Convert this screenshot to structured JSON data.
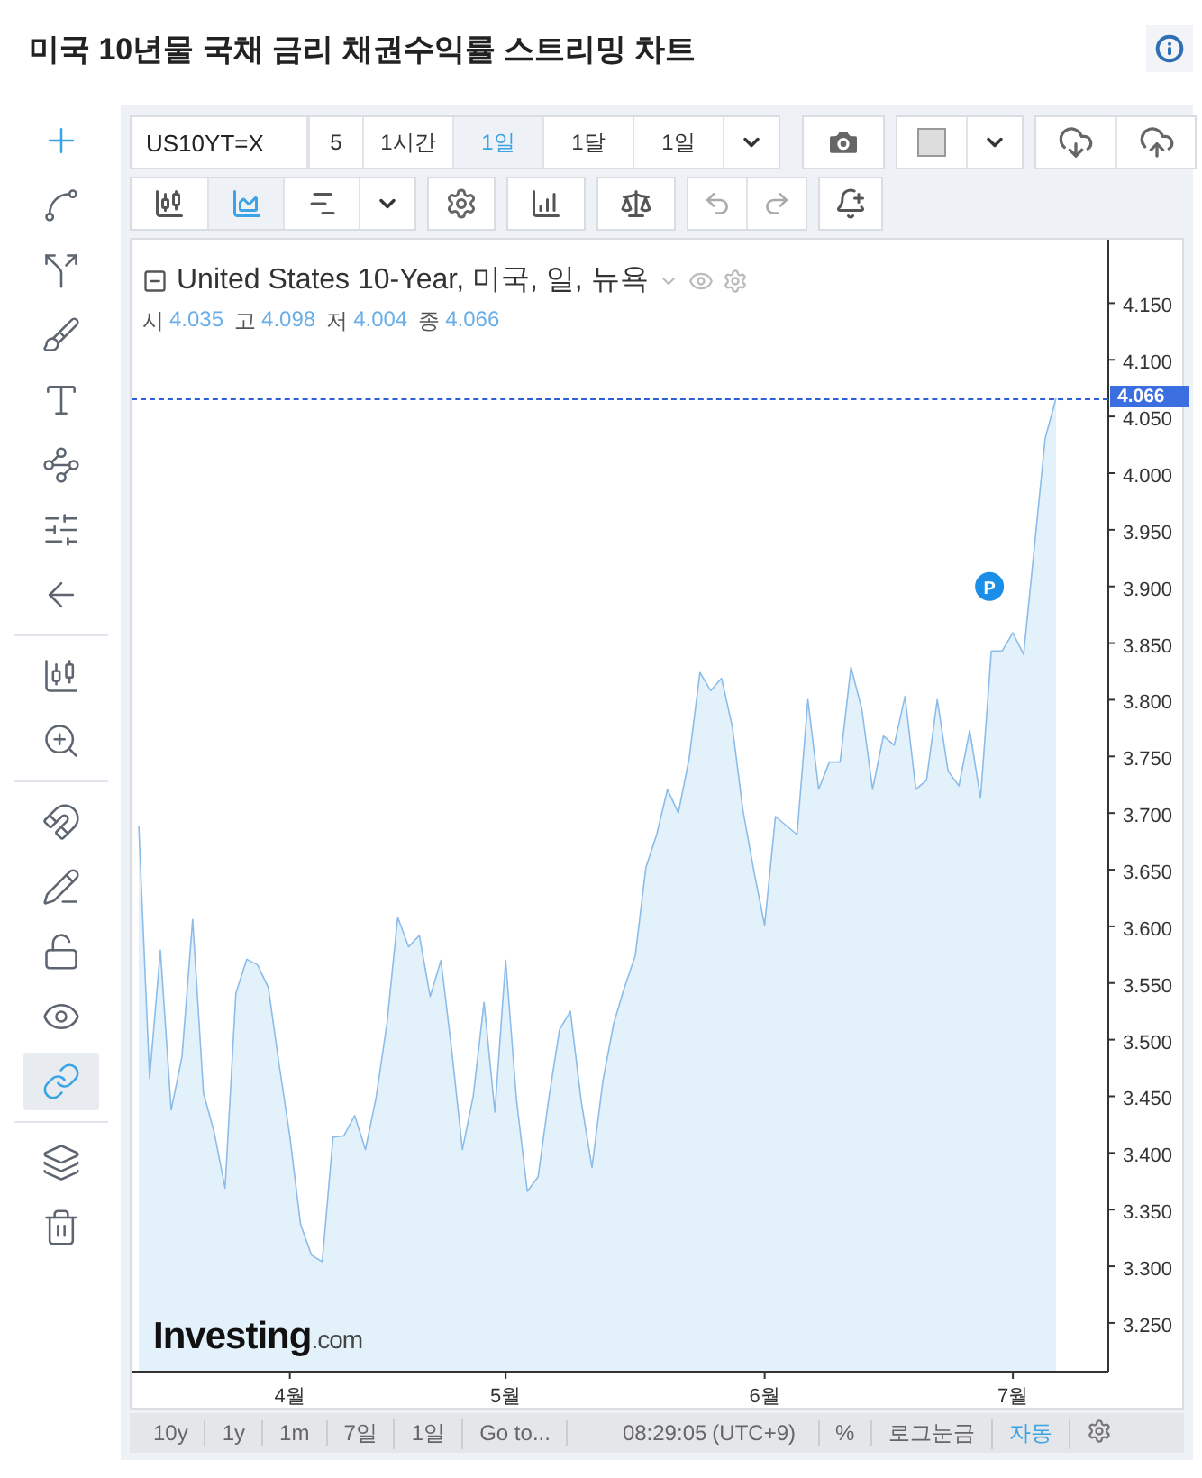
{
  "page_title": "미국 10년물 국채 금리 채권수익률 스트리밍 차트",
  "left_tools": [
    {
      "kind": "crosshair",
      "selected": true
    },
    {
      "kind": "line",
      "selected": false
    },
    {
      "kind": "fork",
      "selected": false
    },
    {
      "kind": "brush",
      "selected": false
    },
    {
      "kind": "text",
      "selected": false
    },
    {
      "kind": "pattern",
      "selected": false
    },
    {
      "kind": "measure",
      "selected": false
    },
    {
      "kind": "back",
      "selected": false
    },
    {
      "kind": "divider"
    },
    {
      "kind": "candle-zoom",
      "selected": false
    },
    {
      "kind": "zoom",
      "selected": false
    },
    {
      "kind": "divider"
    },
    {
      "kind": "magnet",
      "selected": false
    },
    {
      "kind": "pencil-lock",
      "selected": false
    },
    {
      "kind": "lock",
      "selected": false
    },
    {
      "kind": "eye",
      "selected": false
    },
    {
      "kind": "link",
      "selected": true
    },
    {
      "kind": "divider"
    },
    {
      "kind": "layers",
      "selected": false
    },
    {
      "kind": "trash",
      "selected": false
    }
  ],
  "toolbar": {
    "symbol": "US10YT=X",
    "intervals": [
      {
        "label": "5",
        "selected": false
      },
      {
        "label": "1시간",
        "selected": false
      },
      {
        "label": "1일",
        "selected": true
      },
      {
        "label": "1달",
        "selected": false
      },
      {
        "label": "1일",
        "selected": false
      }
    ]
  },
  "chart_types": [
    {
      "kind": "candles",
      "selected": false
    },
    {
      "kind": "area",
      "selected": true
    },
    {
      "kind": "bars",
      "selected": false
    }
  ],
  "legend": {
    "title_suffix": ", 미국, 일, 뉴욕",
    "ohlc": [
      {
        "label": "시",
        "value": "4.035"
      },
      {
        "label": "고",
        "value": "4.098"
      },
      {
        "label": "저",
        "value": "4.004"
      },
      {
        "label": "종",
        "value": "4.066"
      }
    ]
  },
  "last_price": "4.066",
  "marker": "P",
  "logo": {
    "name": "Investing",
    "suffix": ".com"
  },
  "chart_data": {
    "type": "area",
    "ylim": [
      3.207,
      4.206
    ],
    "categories": [
      null,
      null,
      null,
      null,
      null,
      null,
      null,
      null,
      null,
      null,
      null,
      null,
      null,
      null,
      "4월",
      null,
      null,
      null,
      null,
      null,
      null,
      null,
      null,
      null,
      null,
      null,
      null,
      null,
      null,
      null,
      null,
      null,
      null,
      null,
      "5월",
      null,
      null,
      null,
      null,
      null,
      null,
      null,
      null,
      null,
      null,
      null,
      null,
      null,
      null,
      null,
      null,
      null,
      null,
      null,
      null,
      null,
      null,
      null,
      "6월",
      null,
      null,
      null,
      null,
      null,
      null,
      null,
      null,
      null,
      null,
      null,
      null,
      null,
      null,
      null,
      null,
      null,
      null,
      null,
      null,
      null,
      null,
      "7월",
      null,
      null,
      null,
      null
    ],
    "series": [
      {
        "name": "United States 10-Year",
        "color": "#8cbcea",
        "values": [
          3.689,
          3.466,
          3.579,
          3.438,
          3.485,
          3.606,
          3.453,
          3.418,
          3.369,
          3.541,
          3.571,
          3.566,
          3.546,
          3.479,
          3.415,
          3.337,
          3.31,
          3.304,
          3.414,
          3.415,
          3.433,
          3.403,
          3.449,
          3.514,
          3.608,
          3.582,
          3.592,
          3.538,
          3.57,
          3.49,
          3.403,
          3.45,
          3.533,
          3.436,
          3.57,
          3.447,
          3.366,
          3.379,
          3.449,
          3.509,
          3.525,
          3.446,
          3.387,
          3.463,
          3.514,
          3.546,
          3.574,
          3.652,
          3.681,
          3.721,
          3.7,
          3.748,
          3.824,
          3.808,
          3.819,
          3.776,
          3.702,
          3.649,
          3.601,
          3.697,
          3.689,
          3.681,
          3.8,
          3.721,
          3.745,
          3.745,
          3.829,
          3.792,
          3.721,
          3.768,
          3.76,
          3.803,
          3.721,
          3.729,
          3.8,
          3.737,
          3.724,
          3.773,
          3.713,
          3.843,
          3.843,
          3.859,
          3.84,
          3.935,
          4.031,
          4.066
        ]
      }
    ],
    "yticks": [
      {
        "value": 4.15,
        "label": "4.150"
      },
      {
        "value": 4.1,
        "label": "4.100"
      },
      {
        "value": 4.05,
        "label": "4.050"
      },
      {
        "value": 4.0,
        "label": "4.000"
      },
      {
        "value": 3.95,
        "label": "3.950"
      },
      {
        "value": 3.9,
        "label": "3.900"
      },
      {
        "value": 3.85,
        "label": "3.850"
      },
      {
        "value": 3.8,
        "label": "3.800"
      },
      {
        "value": 3.75,
        "label": "3.750"
      },
      {
        "value": 3.7,
        "label": "3.700"
      },
      {
        "value": 3.65,
        "label": "3.650"
      },
      {
        "value": 3.6,
        "label": "3.600"
      },
      {
        "value": 3.55,
        "label": "3.550"
      },
      {
        "value": 3.5,
        "label": "3.500"
      },
      {
        "value": 3.45,
        "label": "3.450"
      },
      {
        "value": 3.4,
        "label": "3.400"
      },
      {
        "value": 3.35,
        "label": "3.350"
      },
      {
        "value": 3.3,
        "label": "3.300"
      },
      {
        "value": 3.25,
        "label": "3.250"
      }
    ]
  },
  "bottom_bar": {
    "ranges": [
      {
        "label": "10y"
      },
      {
        "label": "1y"
      },
      {
        "label": "1m"
      },
      {
        "label": "7일"
      },
      {
        "label": "1일"
      },
      {
        "label": "Go to..."
      }
    ],
    "time": "08:29:05",
    "timezone": "(UTC+9)",
    "options": [
      {
        "label": "%",
        "selected": false
      },
      {
        "label": "로그눈금",
        "selected": false
      },
      {
        "label": "자동",
        "selected": true
      }
    ]
  }
}
